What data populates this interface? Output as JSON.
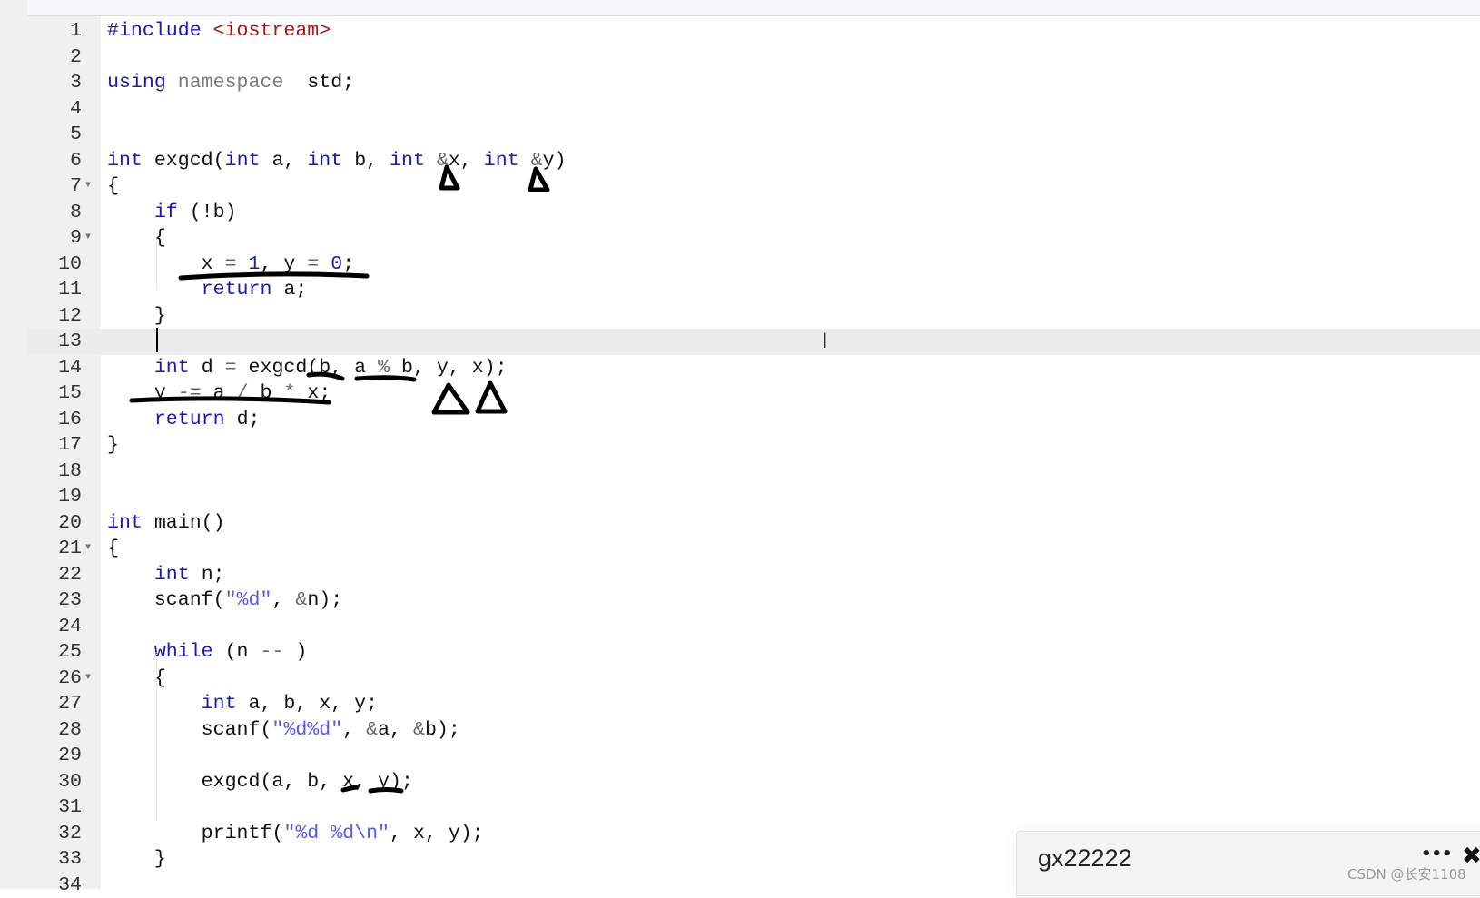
{
  "editor": {
    "active_line": 13,
    "fold_lines": [
      7,
      9,
      21,
      26
    ],
    "lines": [
      [
        [
          "pre",
          "#include "
        ],
        [
          "inc",
          "<iostream>"
        ]
      ],
      [],
      [
        [
          "kw",
          "using "
        ],
        [
          "kw2",
          "namespace"
        ],
        [
          "",
          "  std;"
        ]
      ],
      [],
      [],
      [
        [
          "kw",
          "int"
        ],
        [
          "",
          " exgcd("
        ],
        [
          "kw",
          "int"
        ],
        [
          "",
          " a, "
        ],
        [
          "kw",
          "int"
        ],
        [
          "",
          " b, "
        ],
        [
          "kw",
          "int"
        ],
        [
          "",
          " "
        ],
        [
          "op",
          "&"
        ],
        [
          "",
          "x, "
        ],
        [
          "kw",
          "int"
        ],
        [
          "",
          " "
        ],
        [
          "op",
          "&"
        ],
        [
          "",
          "y)"
        ]
      ],
      [
        [
          "",
          "{"
        ]
      ],
      [
        [
          "",
          "    "
        ],
        [
          "kw",
          "if"
        ],
        [
          "",
          " (!b)"
        ]
      ],
      [
        [
          "",
          "    {"
        ]
      ],
      [
        [
          "",
          "        x "
        ],
        [
          "op",
          "="
        ],
        [
          "",
          " "
        ],
        [
          "num",
          "1"
        ],
        [
          "",
          ", y "
        ],
        [
          "op",
          "="
        ],
        [
          "",
          " "
        ],
        [
          "num",
          "0"
        ],
        [
          "",
          ";"
        ]
      ],
      [
        [
          "",
          "        "
        ],
        [
          "kw",
          "return"
        ],
        [
          "",
          " a;"
        ]
      ],
      [
        [
          "",
          "    }"
        ]
      ],
      [],
      [
        [
          "",
          "    "
        ],
        [
          "kw",
          "int"
        ],
        [
          "",
          " d "
        ],
        [
          "op",
          "="
        ],
        [
          "",
          " exgcd(b, a "
        ],
        [
          "op",
          "%"
        ],
        [
          "",
          " b, y, x);"
        ]
      ],
      [
        [
          "",
          "    y "
        ],
        [
          "op",
          "-="
        ],
        [
          "",
          " a "
        ],
        [
          "op",
          "/"
        ],
        [
          "",
          " b "
        ],
        [
          "op",
          "*"
        ],
        [
          "",
          " x;"
        ]
      ],
      [
        [
          "",
          "    "
        ],
        [
          "kw",
          "return"
        ],
        [
          "",
          " d;"
        ]
      ],
      [
        [
          "",
          "}"
        ]
      ],
      [],
      [],
      [
        [
          "kw",
          "int"
        ],
        [
          "",
          " main()"
        ]
      ],
      [
        [
          "",
          "{"
        ]
      ],
      [
        [
          "",
          "    "
        ],
        [
          "kw",
          "int"
        ],
        [
          "",
          " n;"
        ]
      ],
      [
        [
          "",
          "    scanf("
        ],
        [
          "str",
          "\"%d\""
        ],
        [
          "",
          ", "
        ],
        [
          "op",
          "&"
        ],
        [
          "",
          "n);"
        ]
      ],
      [],
      [
        [
          "",
          "    "
        ],
        [
          "kw",
          "while"
        ],
        [
          "",
          " (n "
        ],
        [
          "op",
          "--"
        ],
        [
          "",
          " )"
        ]
      ],
      [
        [
          "",
          "    {"
        ]
      ],
      [
        [
          "",
          "        "
        ],
        [
          "kw",
          "int"
        ],
        [
          "",
          " a, b, x, y;"
        ]
      ],
      [
        [
          "",
          "        scanf("
        ],
        [
          "str",
          "\"%d%d\""
        ],
        [
          "",
          ", "
        ],
        [
          "op",
          "&"
        ],
        [
          "",
          "a, "
        ],
        [
          "op",
          "&"
        ],
        [
          "",
          "b);"
        ]
      ],
      [],
      [
        [
          "",
          "        exgcd(a, b, x, y);"
        ]
      ],
      [],
      [
        [
          "",
          "        printf("
        ],
        [
          "str",
          "\"%d %d\\n\""
        ],
        [
          "",
          ", x, y);"
        ]
      ],
      [
        [
          "",
          "    }"
        ]
      ],
      []
    ]
  },
  "popup": {
    "title": "gx22222",
    "more_icon": "ellipsis-icon",
    "close_icon": "close-icon"
  },
  "watermark": "CSDN @长安1108"
}
